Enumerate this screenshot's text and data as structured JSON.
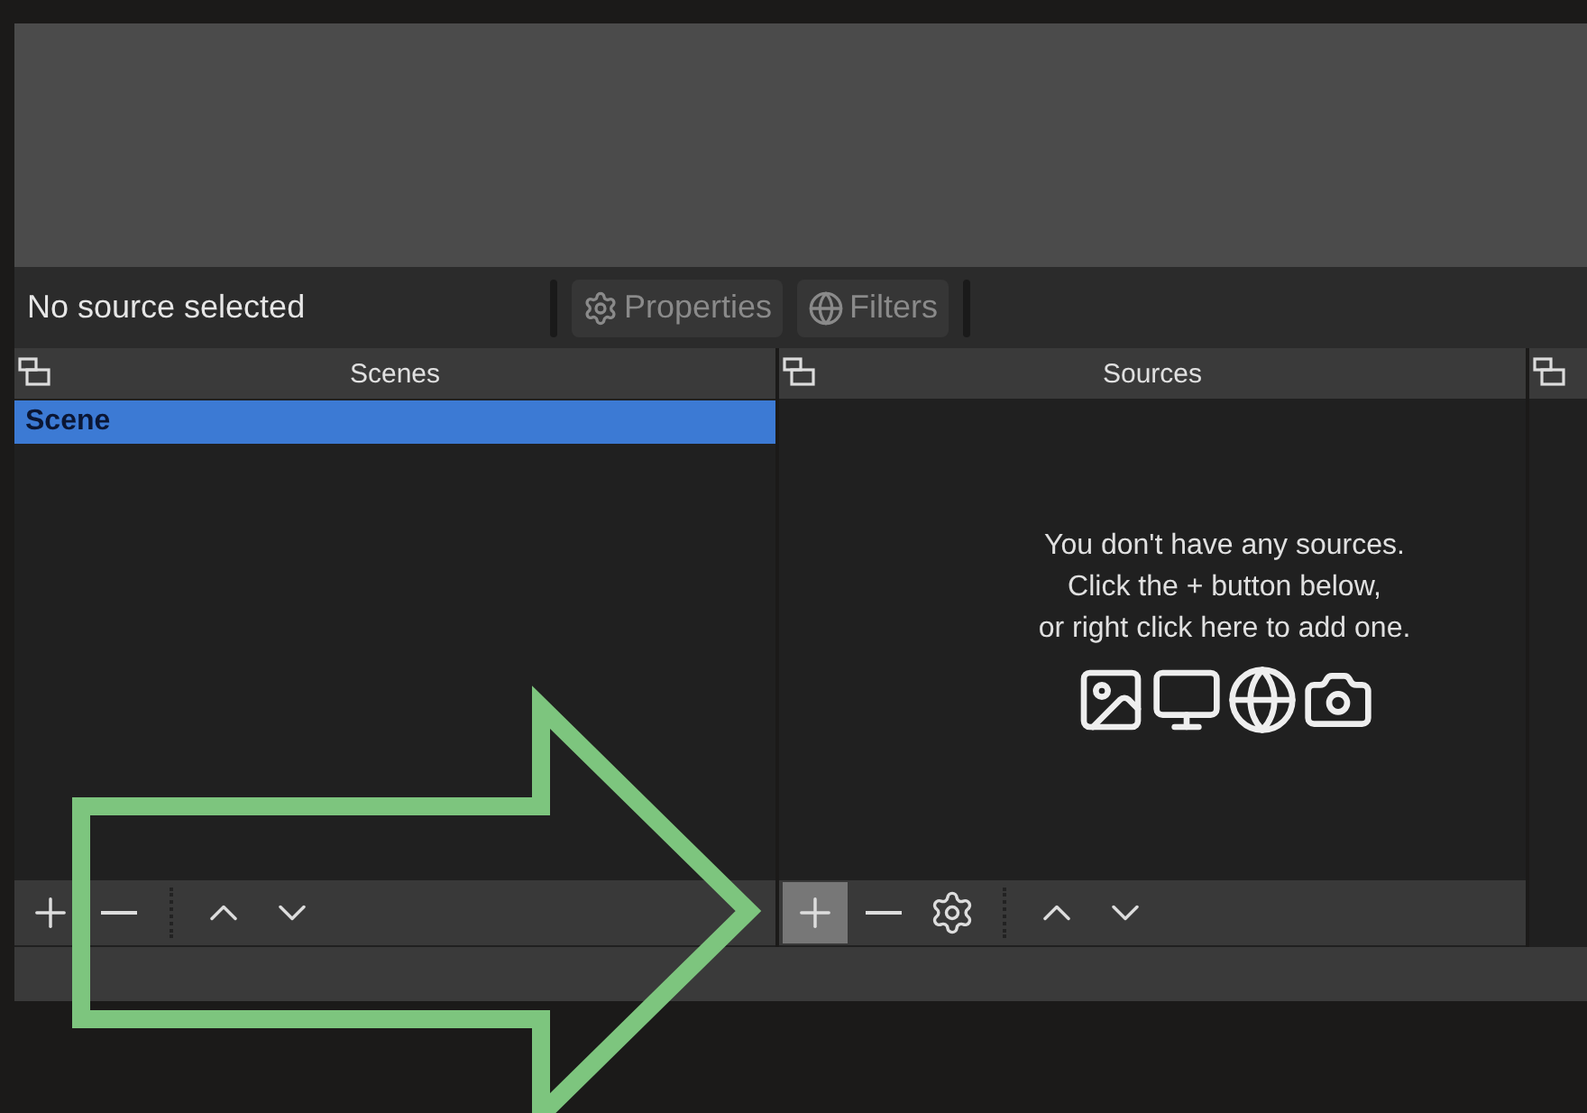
{
  "status": {
    "text": "No source selected"
  },
  "toolbar": [
    {
      "kind": "gear",
      "label": "Properties",
      "disabled": true
    },
    {
      "kind": "filter",
      "label": "Filters",
      "disabled": true
    }
  ],
  "docks": [
    {
      "title": "Scenes",
      "items": [
        {
          "label": "Scene",
          "selected": true
        }
      ],
      "buttons": [
        {
          "kind": "plus",
          "highlighted": false
        },
        {
          "kind": "minus",
          "highlighted": false
        },
        {
          "kind": "sep"
        },
        {
          "kind": "up",
          "highlighted": false
        },
        {
          "kind": "down",
          "highlighted": false
        }
      ]
    },
    {
      "title": "Sources",
      "empty_message": [
        "You don't have any sources.",
        "Click the + button below,",
        "or right click here to add one."
      ],
      "buttons": [
        {
          "kind": "plus",
          "highlighted": true
        },
        {
          "kind": "minus",
          "highlighted": false
        },
        {
          "kind": "gear",
          "highlighted": false
        },
        {
          "kind": "sep"
        },
        {
          "kind": "up",
          "highlighted": false
        },
        {
          "kind": "down",
          "highlighted": false
        }
      ]
    }
  ]
}
